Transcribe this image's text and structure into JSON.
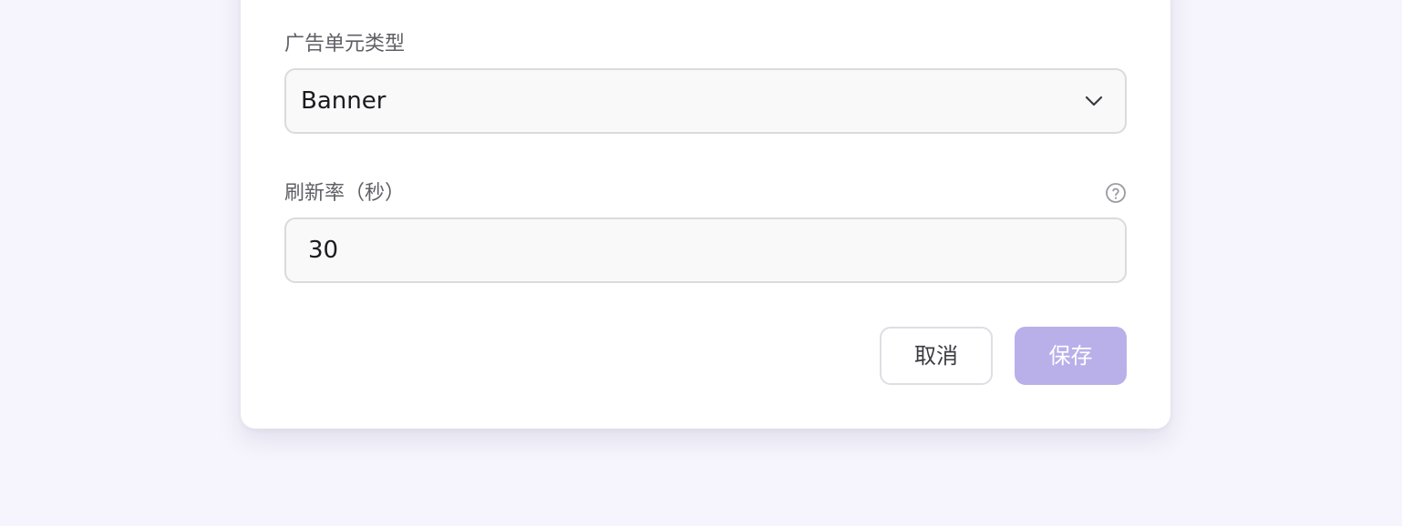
{
  "form": {
    "ad_unit_type": {
      "label": "广告单元类型",
      "selected": "Banner"
    },
    "refresh_rate": {
      "label": "刷新率（秒）",
      "value": "30"
    }
  },
  "actions": {
    "cancel_label": "取消",
    "save_label": "保存"
  },
  "icons": {
    "select_arrow": "chevron-down-icon",
    "help": "help-circle-icon"
  },
  "colors": {
    "page_background": "#f6f5fd",
    "card_background": "#ffffff",
    "primary_disabled": "#b9b0ea",
    "input_border": "#dadadf"
  }
}
